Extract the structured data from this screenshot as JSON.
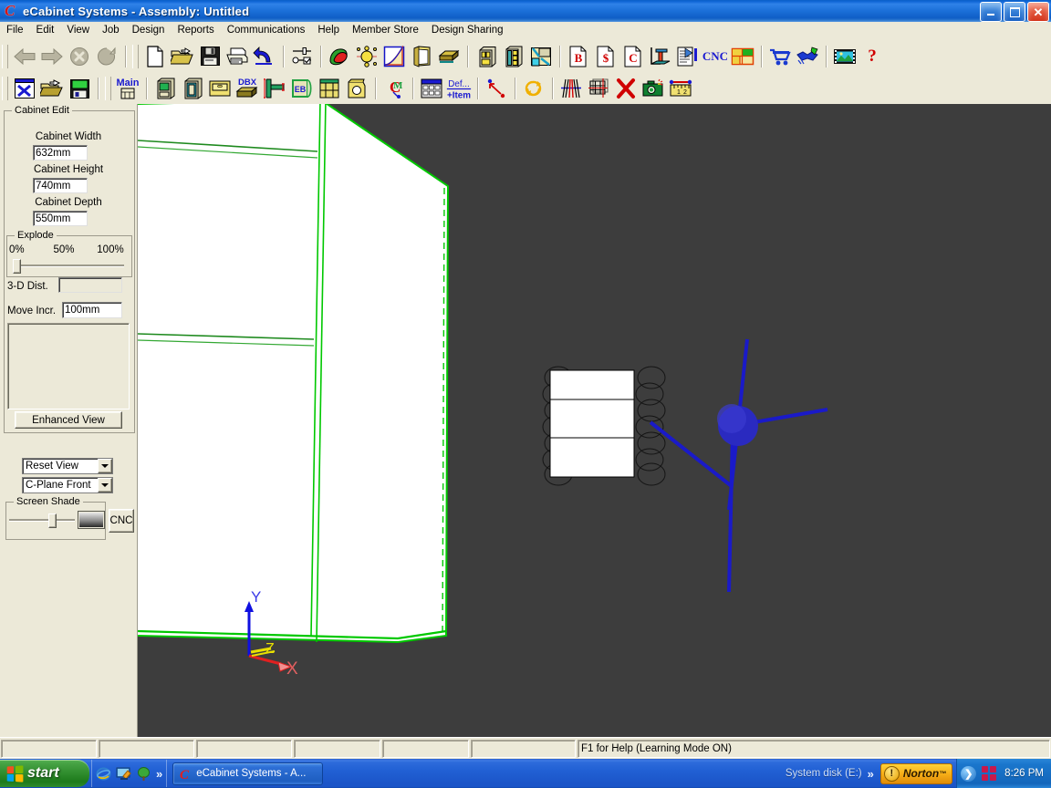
{
  "window": {
    "title": "eCabinet Systems - Assembly: Untitled",
    "app_icon": "ecabinet-c-icon",
    "buttons": {
      "minimize": "minimize",
      "maximize": "maximize",
      "close": "close"
    }
  },
  "menubar": {
    "items": [
      {
        "label": "File"
      },
      {
        "label": "Edit"
      },
      {
        "label": "View"
      },
      {
        "label": "Job"
      },
      {
        "label": "Design"
      },
      {
        "label": "Reports"
      },
      {
        "label": "Communications"
      },
      {
        "label": "Help"
      },
      {
        "label": "Member Store"
      },
      {
        "label": "Design Sharing"
      }
    ]
  },
  "toolbar1": {
    "items": [
      {
        "name": "back-arrow-icon",
        "kind": "icon"
      },
      {
        "name": "forward-arrow-icon",
        "kind": "icon"
      },
      {
        "name": "stop-icon",
        "kind": "icon"
      },
      {
        "name": "refresh-icon",
        "kind": "icon"
      },
      {
        "name": "new-document-icon",
        "kind": "icon"
      },
      {
        "name": "open-folder-icon",
        "kind": "icon"
      },
      {
        "name": "save-disk-icon",
        "kind": "icon"
      },
      {
        "name": "print-icon",
        "kind": "icon"
      },
      {
        "name": "undo-icon",
        "kind": "icon"
      },
      {
        "name": "settings-sliders-icon",
        "kind": "icon"
      },
      {
        "name": "materials-icon",
        "kind": "icon"
      },
      {
        "name": "hardware-icon",
        "kind": "icon"
      },
      {
        "name": "profile-editor-icon",
        "kind": "icon"
      },
      {
        "name": "door-styles-icon",
        "kind": "icon"
      },
      {
        "name": "moulding-icon",
        "kind": "icon"
      },
      {
        "name": "cabinet-library-icon",
        "kind": "icon"
      },
      {
        "name": "assembly-icon",
        "kind": "icon"
      },
      {
        "name": "room-design-icon",
        "kind": "icon"
      },
      {
        "name": "bid-report-icon",
        "label": "B",
        "kind": "text"
      },
      {
        "name": "cost-report-icon",
        "label": "$",
        "kind": "text"
      },
      {
        "name": "cutlist-report-icon",
        "label": "C",
        "kind": "text"
      },
      {
        "name": "elevation-icon",
        "kind": "icon"
      },
      {
        "name": "export-document-icon",
        "kind": "icon"
      },
      {
        "name": "cnc-icon",
        "label": "CNC",
        "kind": "text"
      },
      {
        "name": "nesting-icon",
        "kind": "icon"
      },
      {
        "name": "shopping-cart-icon",
        "kind": "icon"
      },
      {
        "name": "design-sharing-handshake-icon",
        "kind": "icon"
      },
      {
        "name": "media-film-icon",
        "kind": "icon"
      },
      {
        "name": "help-question-icon",
        "label": "?",
        "kind": "text"
      }
    ]
  },
  "toolbar2": {
    "items": [
      {
        "name": "new-assembly-icon",
        "kind": "icon"
      },
      {
        "name": "open-assembly-icon",
        "kind": "icon"
      },
      {
        "name": "save-assembly-icon",
        "kind": "icon"
      },
      {
        "name": "main-screen-icon",
        "label": "Main",
        "kind": "icon"
      },
      {
        "name": "cabinet-box-icon",
        "kind": "icon"
      },
      {
        "name": "cabinet-face-icon",
        "kind": "icon"
      },
      {
        "name": "drawer-icon",
        "kind": "icon"
      },
      {
        "name": "dbx-drawer-box-icon",
        "label": "DBX",
        "kind": "icon"
      },
      {
        "name": "joinery-icon",
        "kind": "icon"
      },
      {
        "name": "edgebanding-icon",
        "label": "EB",
        "kind": "icon"
      },
      {
        "name": "shelf-icon",
        "kind": "icon"
      },
      {
        "name": "hardware-placement-icon",
        "kind": "icon"
      },
      {
        "name": "cnc-machining-icon",
        "kind": "icon"
      },
      {
        "name": "calculator-icon",
        "kind": "icon"
      },
      {
        "name": "define-item-icon",
        "label": "Def... +Item",
        "kind": "icon"
      },
      {
        "name": "point-pick-icon",
        "kind": "icon"
      },
      {
        "name": "rotate-icon",
        "kind": "icon"
      },
      {
        "name": "mirror-icon",
        "kind": "icon"
      },
      {
        "name": "array-grid-icon",
        "kind": "icon"
      },
      {
        "name": "delete-x-icon",
        "kind": "icon"
      },
      {
        "name": "camera-snapshot-icon",
        "kind": "icon"
      },
      {
        "name": "measure-ruler-icon",
        "kind": "icon"
      }
    ]
  },
  "sidebar": {
    "group_title": "Cabinet Edit",
    "fields": [
      {
        "label": "Cabinet Width",
        "value": "632mm"
      },
      {
        "label": "Cabinet Height",
        "value": "740mm"
      },
      {
        "label": "Cabinet Depth",
        "value": "550mm"
      }
    ],
    "explode": {
      "title": "Explode",
      "ticks": [
        "0%",
        "50%",
        "100%"
      ],
      "value": 0
    },
    "dist": {
      "label": "3-D Dist.",
      "value": ""
    },
    "move_incr": {
      "label": "Move Incr.",
      "value": "100mm"
    },
    "enhanced_view_button": "Enhanced View",
    "view_combo": {
      "value": "Reset View"
    },
    "cplane_combo": {
      "value": "C-Plane Front"
    },
    "screen_shade": {
      "title": "Screen Shade",
      "value": 60
    },
    "cnc_button": "CNC"
  },
  "viewport": {
    "background_color": "#3d3d3d",
    "cabinet_fill": "#ffffff",
    "selection_color": "#00d000",
    "gizmo": {
      "x_label": "X",
      "y_label": "Y",
      "z_label": "Z",
      "x_color": "#e02020",
      "y_color": "#1010e0",
      "z_color": "#e0e000"
    },
    "node_color": "#2222bb"
  },
  "statusbar": {
    "panes": [
      "",
      "",
      "",
      "",
      "",
      "",
      "F1 for Help (Learning Mode ON)"
    ],
    "hint": "F1 for Help (Learning Mode ON)"
  },
  "taskbar": {
    "start_label": "start",
    "quicklaunch": [
      {
        "name": "internet-explorer-icon"
      },
      {
        "name": "show-desktop-icon"
      },
      {
        "name": "tree-wallpaper-icon"
      }
    ],
    "quicklaunch_overflow": "»",
    "tasks": [
      {
        "name": "taskbar-item-ecabinet",
        "label": "eCabinet Systems - A..."
      }
    ],
    "tray": {
      "system_disk": "System disk (E:)",
      "overflow": "»",
      "norton": "Norton",
      "norton_tm": "™",
      "clock": "8:26 PM"
    }
  }
}
